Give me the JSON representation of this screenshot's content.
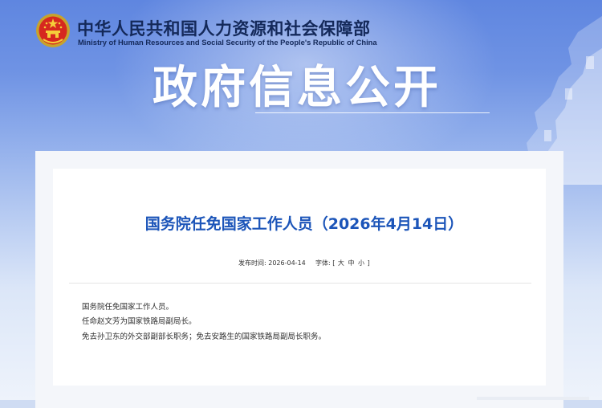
{
  "header": {
    "ministry_cn": "中华人民共和国人力资源和社会保障部",
    "ministry_en": "Ministry of Human Resources and Social Security of the People's Republic of China",
    "banner_title": "政府信息公开"
  },
  "article": {
    "title": "国务院任免国家工作人员（2026年4月14日）",
    "publish_label": "发布时间:",
    "publish_date": "2026-04-14",
    "font_label": "字体:",
    "font_open": "[",
    "font_large": "大",
    "font_medium": "中",
    "font_small": "小",
    "font_close": "]",
    "paragraphs": [
      "国务院任免国家工作人员。",
      "任命赵文芳为国家铁路局副局长。",
      "免去孙卫东的外交部副部长职务；免去安路生的国家铁路局副局长职务。"
    ]
  },
  "colors": {
    "title_blue": "#1c55b9",
    "ministry_navy": "#14295a",
    "banner_blue": "#6f93e4"
  }
}
